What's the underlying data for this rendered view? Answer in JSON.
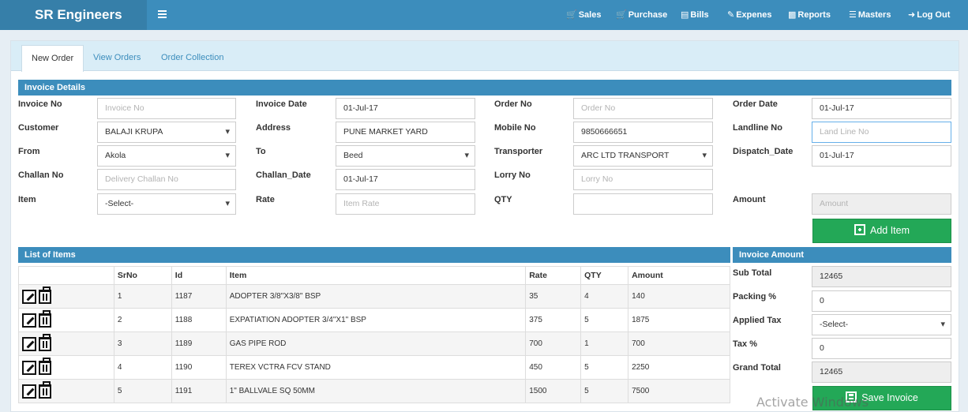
{
  "brand": "SR Engineers",
  "nav": {
    "sales": "Sales",
    "purchase": "Purchase",
    "bills": "Bills",
    "expenses": "Expenes",
    "reports": "Reports",
    "masters": "Masters",
    "logout": "Log Out"
  },
  "tabs": {
    "new_order": "New Order",
    "view_orders": "View Orders",
    "order_collection": "Order Collection"
  },
  "invoice": {
    "heading": "Invoice Details",
    "invoice_no": {
      "label": "Invoice No",
      "placeholder": "Invoice No"
    },
    "invoice_date": {
      "label": "Invoice Date",
      "value": "01-Jul-17"
    },
    "order_no": {
      "label": "Order No",
      "placeholder": "Order No"
    },
    "order_date": {
      "label": "Order Date",
      "value": "01-Jul-17"
    },
    "customer": {
      "label": "Customer",
      "value": "BALAJI KRUPA"
    },
    "address": {
      "label": "Address",
      "value": "PUNE MARKET YARD"
    },
    "mobile": {
      "label": "Mobile No",
      "value": "9850666651"
    },
    "landline": {
      "label": "Landline No",
      "placeholder": "Land Line No"
    },
    "from": {
      "label": "From",
      "value": "Akola"
    },
    "to": {
      "label": "To",
      "value": "Beed"
    },
    "transporter": {
      "label": "Transporter",
      "value": "ARC LTD TRANSPORT"
    },
    "dispatch_date": {
      "label": "Dispatch_Date",
      "value": "01-Jul-17"
    },
    "challan_no": {
      "label": "Challan No",
      "placeholder": "Delivery Challan No"
    },
    "challan_date": {
      "label": "Challan_Date",
      "value": "01-Jul-17"
    },
    "lorry_no": {
      "label": "Lorry No",
      "placeholder": "Lorry No"
    },
    "item": {
      "label": "Item",
      "value": "-Select-"
    },
    "rate": {
      "label": "Rate",
      "placeholder": "Item Rate"
    },
    "qty": {
      "label": "QTY",
      "value": ""
    },
    "amount": {
      "label": "Amount",
      "placeholder": "Amount"
    },
    "add_item": "Add Item"
  },
  "items": {
    "heading": "List of Items",
    "columns": [
      "",
      "SrNo",
      "Id",
      "Item",
      "Rate",
      "QTY",
      "Amount"
    ],
    "rows": [
      {
        "srno": "1",
        "id": "1187",
        "item": "ADOPTER 3/8\"X3/8\" BSP",
        "rate": "35",
        "qty": "4",
        "amount": "140"
      },
      {
        "srno": "2",
        "id": "1188",
        "item": "EXPATIATION ADOPTER 3/4\"X1\" BSP",
        "rate": "375",
        "qty": "5",
        "amount": "1875"
      },
      {
        "srno": "3",
        "id": "1189",
        "item": "GAS PIPE ROD",
        "rate": "700",
        "qty": "1",
        "amount": "700"
      },
      {
        "srno": "4",
        "id": "1190",
        "item": "TEREX VCTRA FCV STAND",
        "rate": "450",
        "qty": "5",
        "amount": "2250"
      },
      {
        "srno": "5",
        "id": "1191",
        "item": "1\" BALLVALE SQ 50MM",
        "rate": "1500",
        "qty": "5",
        "amount": "7500"
      }
    ]
  },
  "totals": {
    "heading": "Invoice Amount",
    "sub_total": {
      "label": "Sub Total",
      "value": "12465"
    },
    "packing": {
      "label": "Packing %",
      "value": "0"
    },
    "applied_tax": {
      "label": "Applied Tax",
      "value": "-Select-"
    },
    "tax": {
      "label": "Tax %",
      "value": "0"
    },
    "grand_total": {
      "label": "Grand Total",
      "value": "12465"
    },
    "save": "Save Invoice"
  },
  "watermark": "Activate Windows"
}
